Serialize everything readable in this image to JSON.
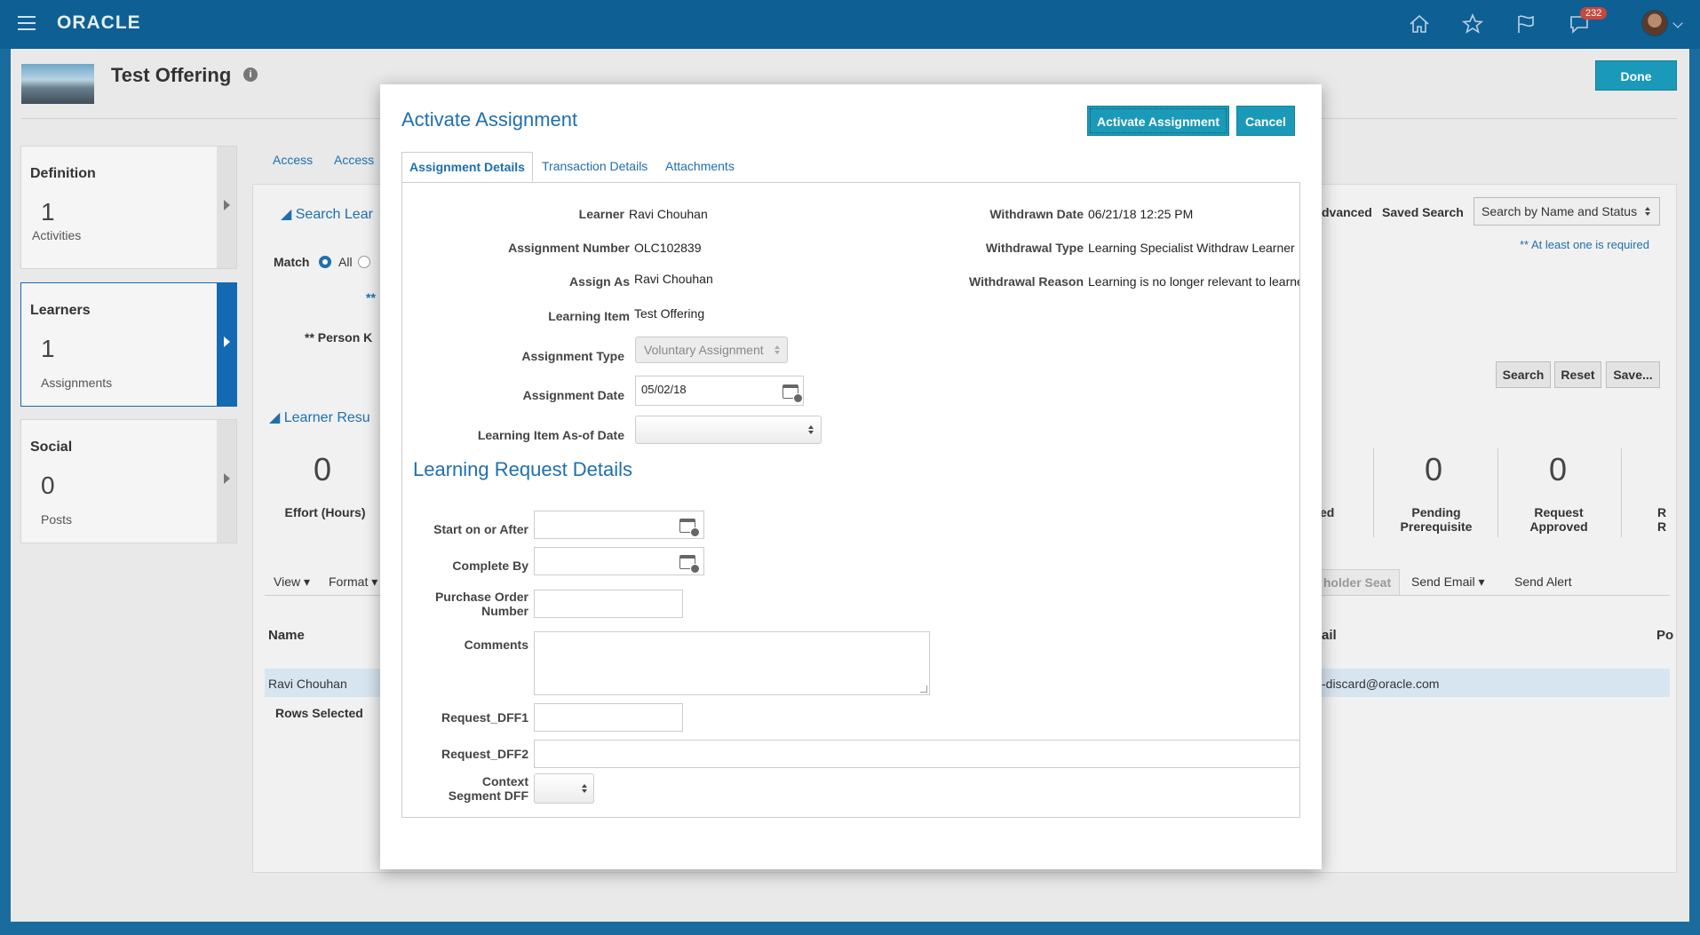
{
  "topbar": {
    "logo": "ORACLE",
    "notification_count": "232"
  },
  "page": {
    "title": "Test Offering",
    "done_label": "Done",
    "panels": [
      {
        "title": "Definition",
        "count": "1",
        "label": "Activities"
      },
      {
        "title": "Learners",
        "count": "1",
        "label": "Assignments"
      },
      {
        "title": "Social",
        "count": "0",
        "label": "Posts"
      }
    ],
    "tabs": [
      "Access",
      "Access"
    ],
    "search_section": "Search Lear",
    "match_label": "Match",
    "match_all": "All",
    "required_marker": "**",
    "person_label": "** Person K",
    "advanced_label": "dvanced",
    "saved_search_label": "Saved Search",
    "saved_search_value": "Search by Name and Status",
    "required_note": "** At least one is required",
    "search_btn": "Search",
    "reset_btn": "Reset",
    "save_btn": "Save...",
    "learner_results": "Learner Resu",
    "stats": [
      {
        "value": "0",
        "label": "Effort (Hours)"
      },
      {
        "value": "0",
        "label": "Pending Prerequisite"
      },
      {
        "value": "0",
        "label": "Request Approved"
      }
    ],
    "stat_partial_left": "ed",
    "stat_partial_right": "R\nR",
    "toolbar": {
      "view": "View",
      "format": "Format",
      "placeholder_seat": "holder Seat",
      "send_email": "Send Email",
      "send_alert": "Send Alert"
    },
    "table": {
      "name_header": "Name",
      "email_header": "ail",
      "p_header": "Po",
      "row_name": "Ravi Chouhan",
      "row_email": "-discard@oracle.com",
      "rows_selected": "Rows Selected"
    }
  },
  "modal": {
    "title": "Activate Assignment",
    "activate_btn": "Activate Assignment",
    "cancel_btn": "Cancel",
    "tabs": [
      "Assignment Details",
      "Transaction Details",
      "Attachments"
    ],
    "fields": {
      "learner": {
        "label": "Learner",
        "value": "Ravi Chouhan"
      },
      "assignment_number": {
        "label": "Assignment Number",
        "value": "OLC102839"
      },
      "assign_as": {
        "label": "Assign As",
        "value": "Ravi Chouhan"
      },
      "learning_item": {
        "label": "Learning Item",
        "value": "Test Offering"
      },
      "assignment_type": {
        "label": "Assignment Type",
        "value": "Voluntary Assignment"
      },
      "assignment_date": {
        "label": "Assignment Date",
        "value": "05/02/18"
      },
      "learning_item_asof": {
        "label": "Learning Item As-of Date",
        "value": ""
      },
      "withdrawn_date": {
        "label": "Withdrawn Date",
        "value": "06/21/18 12:25 PM"
      },
      "withdrawal_type": {
        "label": "Withdrawal Type",
        "value": "Learning Specialist Withdraw Learner"
      },
      "withdrawal_reason": {
        "label": "Withdrawal Reason",
        "value": "Learning is no longer relevant to learner"
      }
    },
    "request_section": "Learning Request Details",
    "request_fields": {
      "start_on_after": "Start on or After",
      "complete_by": "Complete By",
      "po_line1": "Purchase Order",
      "po_line2": "Number",
      "comments": "Comments",
      "dff1": "Request_DFF1",
      "dff2": "Request_DFF2",
      "context_line1": "Context",
      "context_line2": "Segment DFF"
    }
  },
  "colors": {
    "accent": "#1f6fae",
    "button": "#1a9ab8",
    "topbar": "#0e5f94"
  }
}
